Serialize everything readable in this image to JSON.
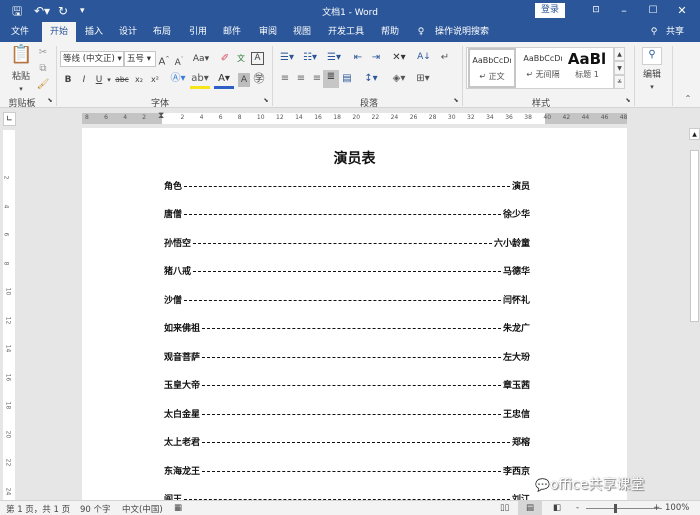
{
  "titlebar": {
    "title": "文档1 - Word",
    "save_icon": "save-icon",
    "undo_icon": "undo-icon",
    "redo_icon": "redo-icon",
    "customize_icon": "customize-qat-icon",
    "login_label": "登录",
    "ribbon_display_icon": "ribbon-display-options-icon",
    "minimize_icon": "minimize-icon",
    "maximize_icon": "maximize-icon",
    "close_icon": "close-icon"
  },
  "tabs": [
    {
      "label": "文件"
    },
    {
      "label": "开始",
      "active": true
    },
    {
      "label": "插入"
    },
    {
      "label": "设计"
    },
    {
      "label": "布局"
    },
    {
      "label": "引用"
    },
    {
      "label": "邮件"
    },
    {
      "label": "审阅"
    },
    {
      "label": "视图"
    },
    {
      "label": "开发工具"
    },
    {
      "label": "帮助"
    }
  ],
  "tell_me": "操作说明搜索",
  "share_label": "共享",
  "ribbon": {
    "clipboard": {
      "label": "剪贴板",
      "paste_label": "粘贴"
    },
    "font": {
      "label": "字体",
      "font_name": "等线 (中文正)",
      "font_size": "五号",
      "grow_label": "A",
      "shrink_label": "A",
      "case_label": "Aa",
      "bold": "B",
      "italic": "I",
      "underline": "U",
      "strike": "abc",
      "subscript": "x₂",
      "superscript": "x²"
    },
    "paragraph": {
      "label": "段落"
    },
    "styles": {
      "label": "样式",
      "items": [
        {
          "sample": "AaBbCcDı",
          "name": "↵ 正文"
        },
        {
          "sample": "AaBbCcDı",
          "name": "↵ 无间隔"
        },
        {
          "sample": "AaBl",
          "name": "标题 1"
        }
      ]
    },
    "editing": {
      "label": "编辑"
    }
  },
  "ruler": {
    "h_ticks": [
      "8",
      "6",
      "4",
      "2",
      "",
      "2",
      "4",
      "6",
      "8",
      "10",
      "12",
      "14",
      "16",
      "18",
      "20",
      "22",
      "24",
      "26",
      "28",
      "30",
      "32",
      "34",
      "36",
      "38",
      "40",
      "42",
      "44",
      "46",
      "48"
    ],
    "v_ticks": [
      "2",
      "4",
      "6",
      "8",
      "10",
      "12",
      "14",
      "16",
      "18",
      "20",
      "22",
      "24"
    ]
  },
  "document": {
    "heading": "演员表",
    "rows": [
      {
        "role": "角色",
        "actor": "演员"
      },
      {
        "role": "唐僧",
        "actor": "徐少华"
      },
      {
        "role": "孙悟空",
        "actor": "六小龄童"
      },
      {
        "role": "猪八戒",
        "actor": "马德华"
      },
      {
        "role": "沙僧",
        "actor": "闫怀礼"
      },
      {
        "role": "如来佛祖",
        "actor": "朱龙广"
      },
      {
        "role": "观音菩萨",
        "actor": "左大玢"
      },
      {
        "role": "玉皇大帝",
        "actor": "章玉茜"
      },
      {
        "role": "太白金星",
        "actor": "王忠信"
      },
      {
        "role": "太上老君",
        "actor": "郑榕"
      },
      {
        "role": "东海龙王",
        "actor": "李西京"
      },
      {
        "role": "阎王",
        "actor": "刘江"
      }
    ]
  },
  "statusbar": {
    "page": "第 1 页，共 1 页",
    "words": "90 个字",
    "language": "中文(中国)",
    "zoom": "100%",
    "zoom_minus": "-",
    "zoom_plus": "+"
  },
  "watermark": "office共享课堂"
}
